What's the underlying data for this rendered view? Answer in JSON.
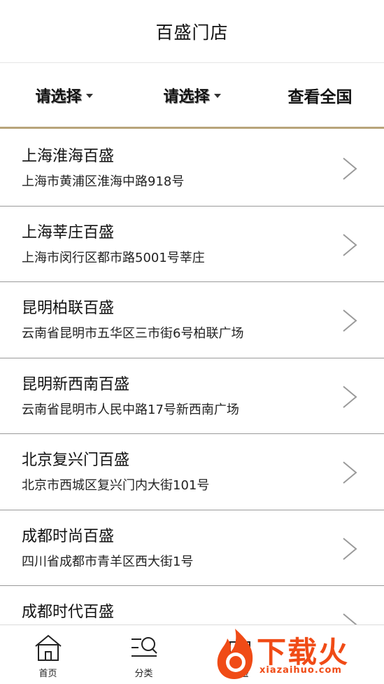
{
  "header": {
    "title": "百盛门店"
  },
  "filters": [
    {
      "label": "请选择",
      "has_caret": true
    },
    {
      "label": "请选择",
      "has_caret": true
    },
    {
      "label": "查看全国",
      "has_caret": false
    }
  ],
  "stores": [
    {
      "name": "上海淮海百盛",
      "address": "上海市黄浦区淮海中路918号"
    },
    {
      "name": "上海莘庄百盛",
      "address": "上海市闵行区都市路5001号莘庄"
    },
    {
      "name": "昆明柏联百盛",
      "address": "云南省昆明市五华区三市街6号柏联广场"
    },
    {
      "name": "昆明新西南百盛",
      "address": "云南省昆明市人民中路17号新西南广场"
    },
    {
      "name": "北京复兴门百盛",
      "address": "北京市西城区复兴门内大街101号"
    },
    {
      "name": "成都时尚百盛",
      "address": "四川省成都市青羊区西大街1号"
    },
    {
      "name": "成都时代百盛",
      "address": ""
    }
  ],
  "tabbar": {
    "tabs": [
      {
        "label": "首页",
        "icon": "home-icon"
      },
      {
        "label": "分类",
        "icon": "category-search-icon"
      },
      {
        "label": "百盛",
        "icon": "store-icon"
      }
    ]
  },
  "watermark": {
    "text": "下载火",
    "url": "xiazaihuo.com"
  },
  "colors": {
    "accent_line": "#b8a47a",
    "watermark": "#f04b16"
  }
}
